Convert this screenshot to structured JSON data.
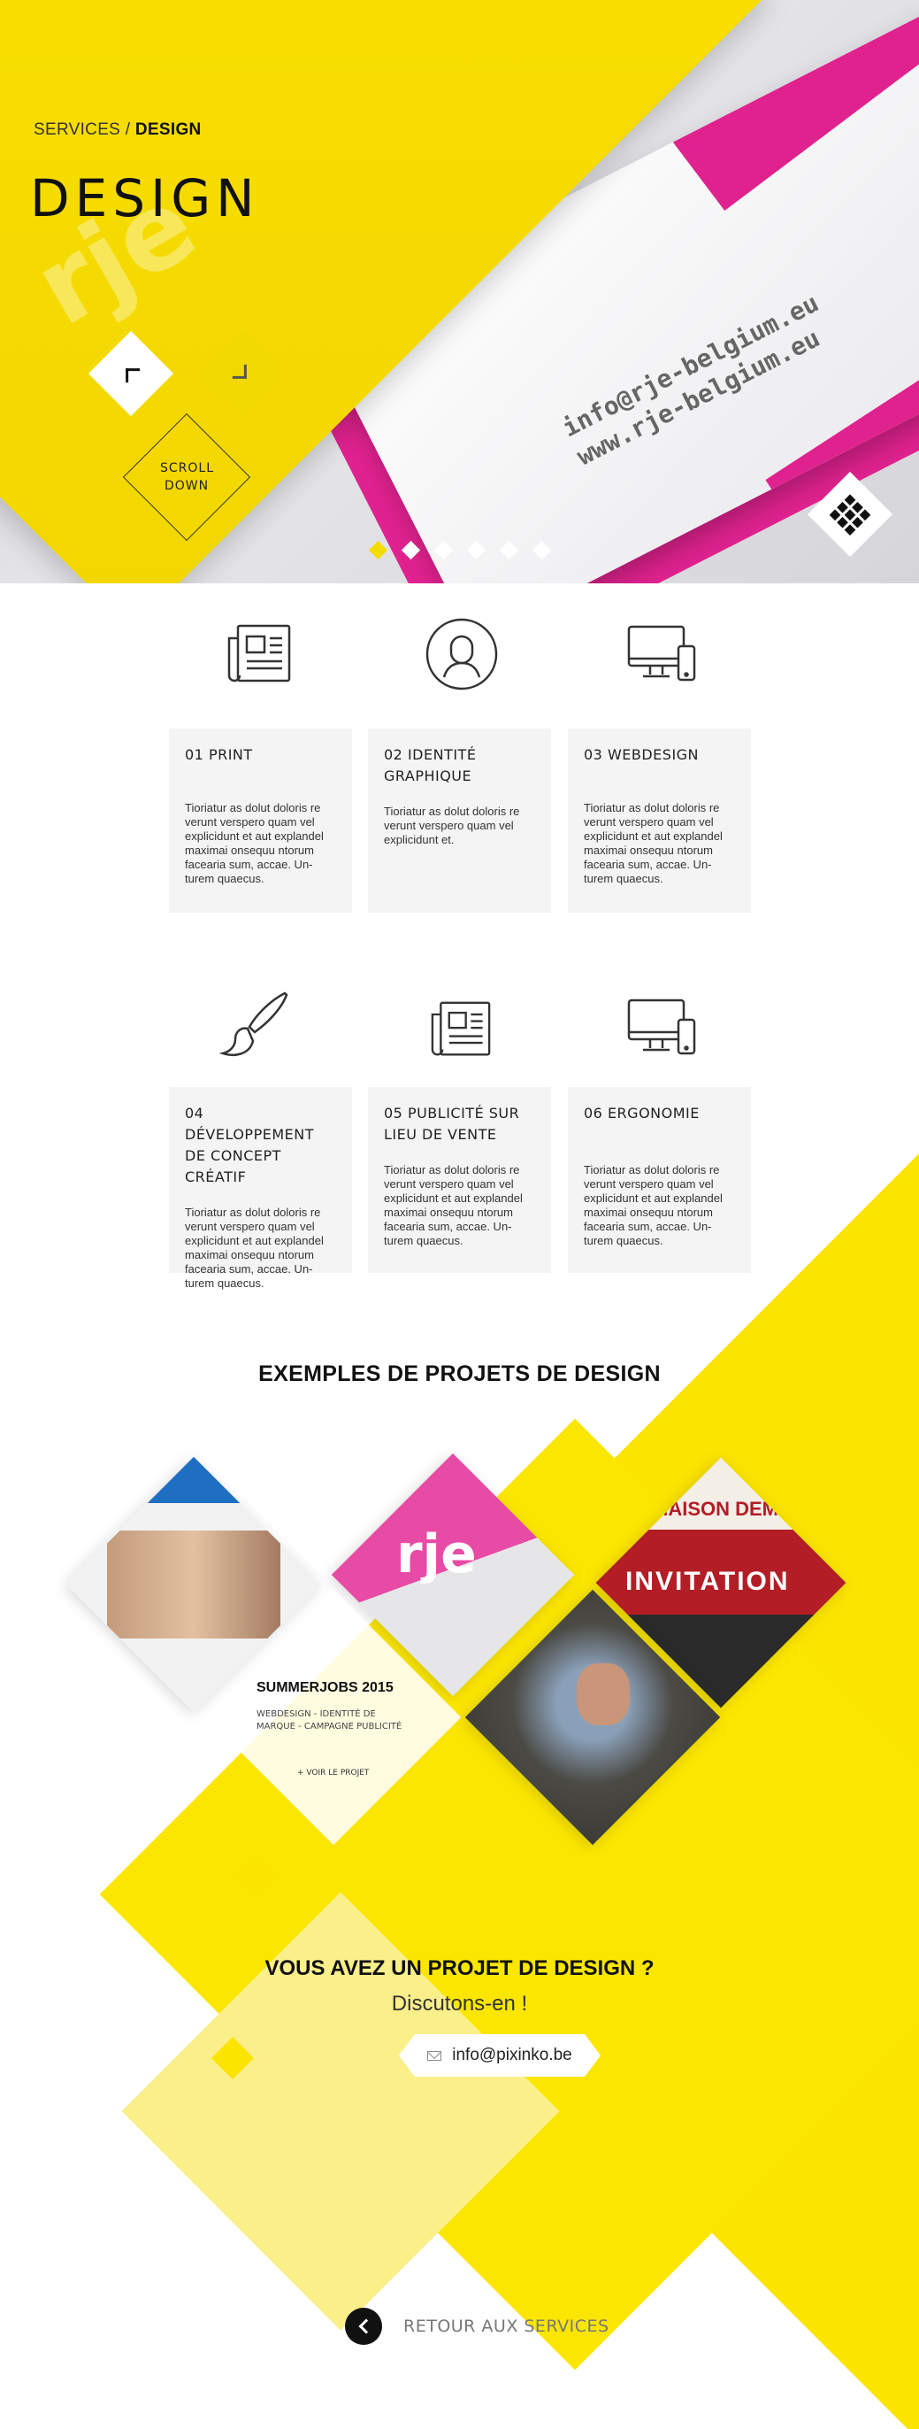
{
  "hero": {
    "breadcrumb_parent": "SERVICES",
    "breadcrumb_sep": " / ",
    "breadcrumb_current": "DESIGN",
    "title": "DESIGN",
    "scroll_label": "SCROLL DOWN",
    "card_line1": "info@rje-belgium.eu",
    "card_line2": "www.rje-belgium.eu",
    "slides": 6,
    "active_slide": 1
  },
  "services": [
    {
      "title": "01 PRINT",
      "icon": "newspaper-icon",
      "text": "Tioriatur as dolut doloris re verunt verspero quam vel explicidunt et aut explandel maximai onsequu ntorum facearia sum, accae. Un-turem quaecus."
    },
    {
      "title": "02 IDENTITÉ GRAPHIQUE",
      "icon": "user-circle-icon",
      "text": "Tioriatur as dolut doloris re verunt verspero quam vel explicidunt et."
    },
    {
      "title": "03 WEBDESIGN",
      "icon": "devices-icon",
      "text": "Tioriatur as dolut doloris re verunt verspero quam vel explicidunt et aut explandel maximai onsequu ntorum facearia sum, accae. Un-turem quaecus."
    },
    {
      "title": "04 DÉVELOPPEMENT DE CONCEPT CRÉATIF",
      "icon": "brush-icon",
      "text": "Tioriatur as dolut doloris re verunt verspero quam vel explicidunt et aut explandel maximai onsequu ntorum facearia sum, accae. Un-turem quaecus."
    },
    {
      "title": "05 PUBLICITÉ SUR LIEU DE VENTE",
      "icon": "newspaper-icon",
      "text": "Tioriatur as dolut doloris re verunt verspero quam vel explicidunt et aut explandel maximai onsequu ntorum facearia sum, accae. Un-turem quaecus."
    },
    {
      "title": "06 ERGONOMIE",
      "icon": "devices-icon",
      "text": "Tioriatur as dolut doloris re verunt verspero quam vel explicidunt et aut explandel maximai onsequu ntorum facearia sum, accae. Un-turem quaecus."
    }
  ],
  "projects": {
    "title": "EXEMPLES DE PROJETS DE DESIGN",
    "featured_title": "SUMMERJOBS 2015",
    "featured_sub": "WEBDESIGN - IDENTITÉ DE MARQUE - CAMPAGNE PUBLICITÉ",
    "featured_link": "+ VOIR LE PROJET",
    "invitation_word": "INVITATION",
    "maison_word": "MAISON DEMOULIN",
    "logo_word": "rje"
  },
  "cta": {
    "title": "VOUS AVEZ UN PROJET DE DESIGN ?",
    "subtitle": "Discutons-en !",
    "email": "info@pixinko.be"
  },
  "footer": {
    "back_label": "RETOUR AUX SERVICES"
  },
  "colors": {
    "accent_yellow": "#fbe400",
    "accent_pink": "#e0228f",
    "dark": "#111111"
  }
}
